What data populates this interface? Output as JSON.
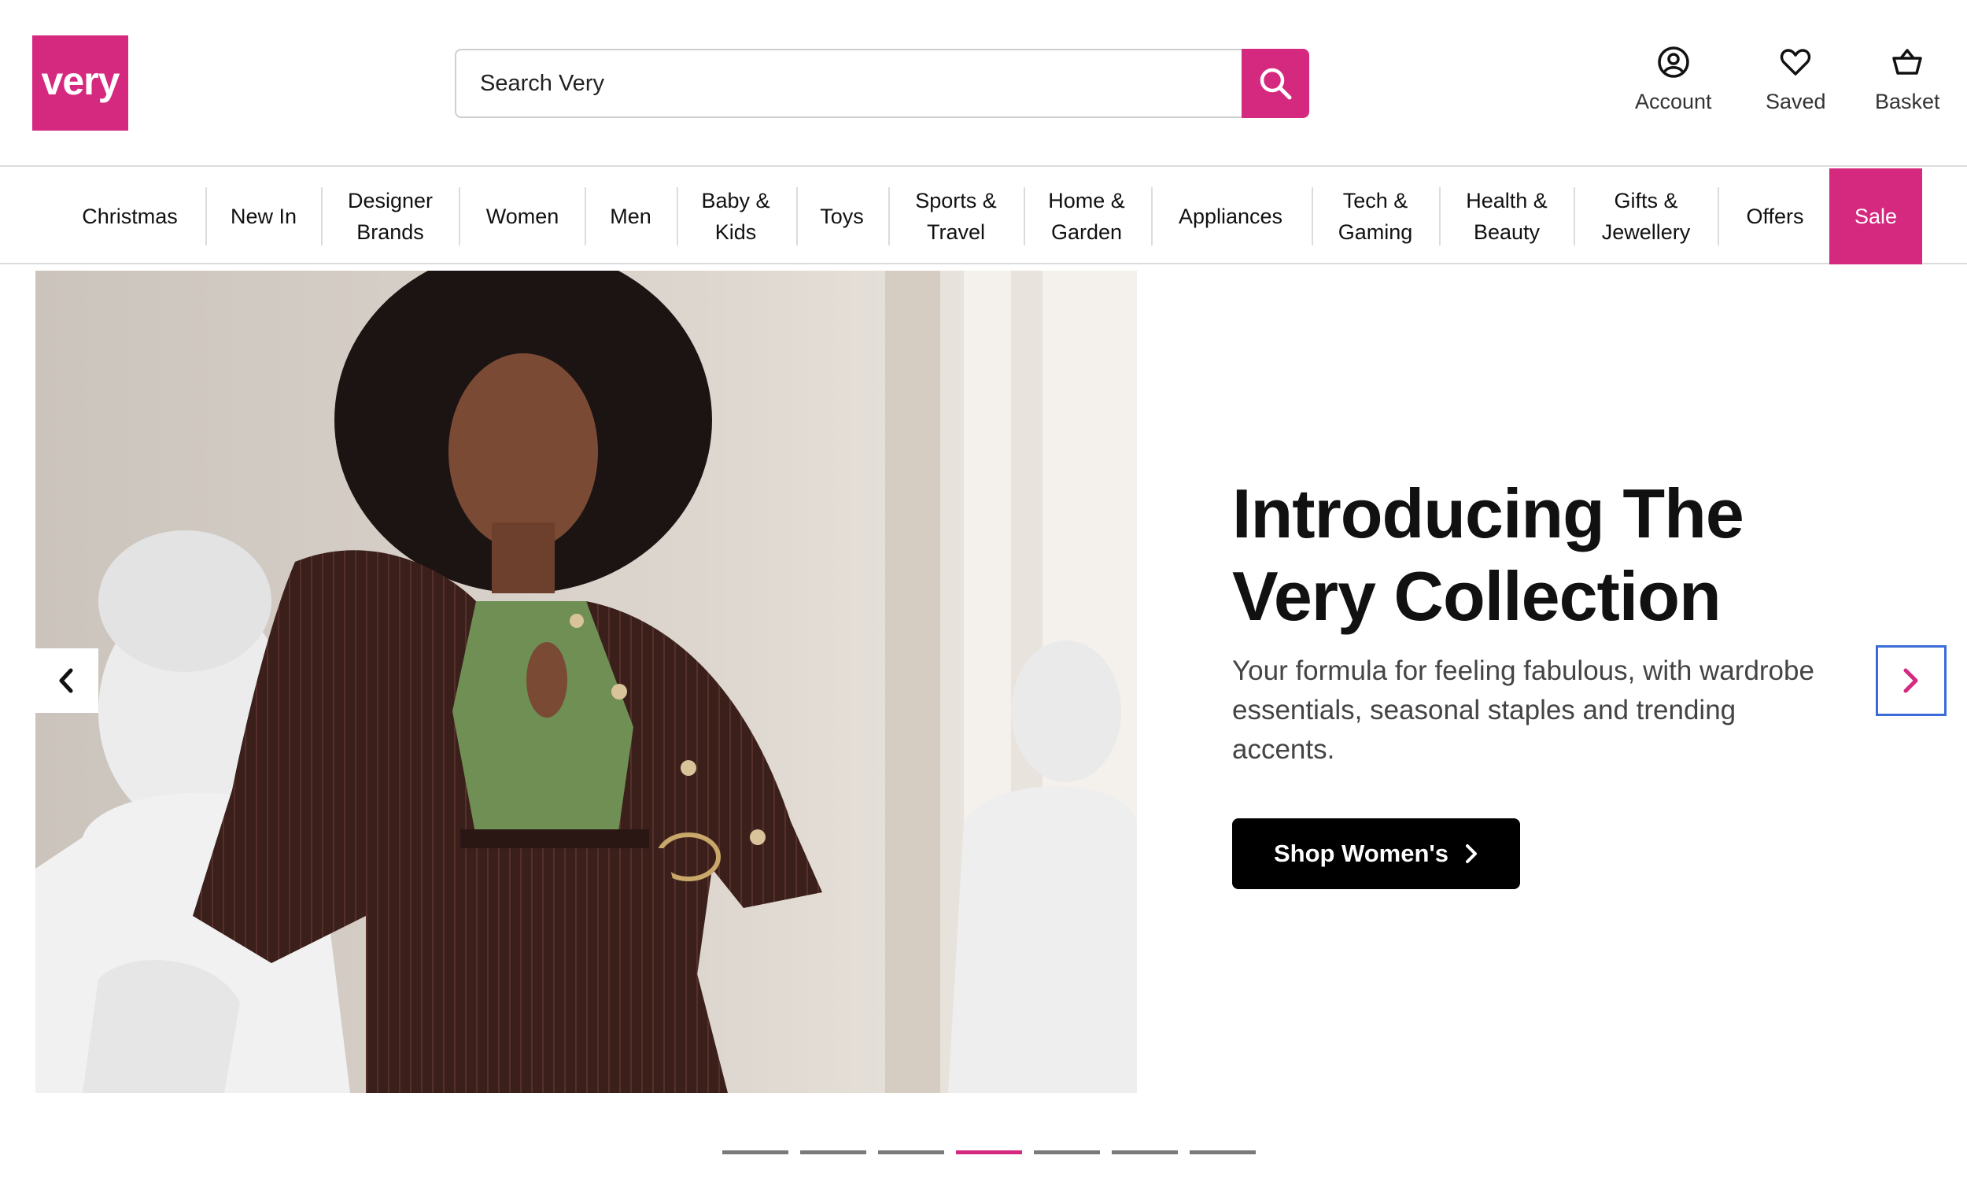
{
  "brand": {
    "logo_text": "very",
    "accent": "#d5297f"
  },
  "search": {
    "placeholder": "Search Very",
    "button_icon": "search-icon"
  },
  "utility": [
    {
      "label": "Account",
      "icon": "account-icon"
    },
    {
      "label": "Saved",
      "icon": "heart-icon"
    },
    {
      "label": "Basket",
      "icon": "basket-icon"
    }
  ],
  "nav": {
    "items": [
      {
        "label": "Christmas"
      },
      {
        "label": "New In"
      },
      {
        "label": "Designer\nBrands"
      },
      {
        "label": "Women"
      },
      {
        "label": "Men"
      },
      {
        "label": "Baby &\nKids"
      },
      {
        "label": "Toys"
      },
      {
        "label": "Sports &\nTravel"
      },
      {
        "label": "Home &\nGarden"
      },
      {
        "label": "Appliances"
      },
      {
        "label": "Tech &\nGaming"
      },
      {
        "label": "Health &\nBeauty"
      },
      {
        "label": "Gifts &\nJewellery"
      },
      {
        "label": "Offers"
      },
      {
        "label": "Sale"
      }
    ]
  },
  "hero": {
    "headline": "Introducing The Very Collection",
    "subtext": "Your formula for feeling fabulous, with wardrobe essentials, seasonal staples and trending accents.",
    "cta_label": "Shop Women's",
    "prev_icon": "chevron-left-icon",
    "next_icon": "chevron-right-icon"
  },
  "carousel": {
    "slide_count": 7,
    "active_index": 3
  }
}
